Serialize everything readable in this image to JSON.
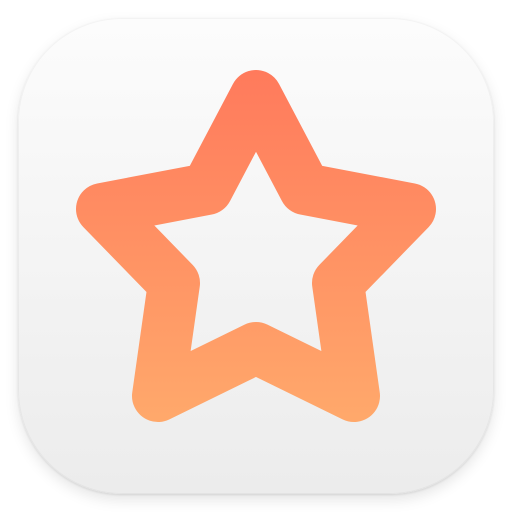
{
  "app_icon": {
    "glyph": "star-outline-icon",
    "colors": {
      "tile_top": "#fcfcfc",
      "tile_bottom": "#ececec",
      "star_gradient_top": "#ff7a5c",
      "star_gradient_bottom": "#ffab6c"
    }
  }
}
